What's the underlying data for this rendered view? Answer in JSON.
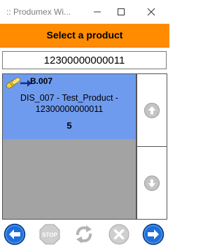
{
  "window": {
    "title": ":: Produmex Wi...",
    "controls": [
      "minimize-icon",
      "maximize-icon",
      "close-icon"
    ]
  },
  "header": {
    "title": "Select a product"
  },
  "search": {
    "value": "12300000000011"
  },
  "products": [
    {
      "icon": "batch-pills-icon",
      "code": "B.007",
      "description": "DIS_007 - Test_Product - 12300000000011",
      "quantity": "5"
    }
  ],
  "scroll": {
    "up_icon": "arrow-up-icon",
    "down_icon": "arrow-down-icon"
  },
  "toolbar": {
    "buttons": [
      "back-icon",
      "stop-icon",
      "refresh-icon",
      "cancel-icon",
      "next-icon"
    ],
    "stop_label": "STOP"
  },
  "colors": {
    "header": "#ff8c00",
    "selected_item": "#6f9bef",
    "list_background": "#a3a3a3",
    "nav_blue": "#1e6fd9"
  }
}
